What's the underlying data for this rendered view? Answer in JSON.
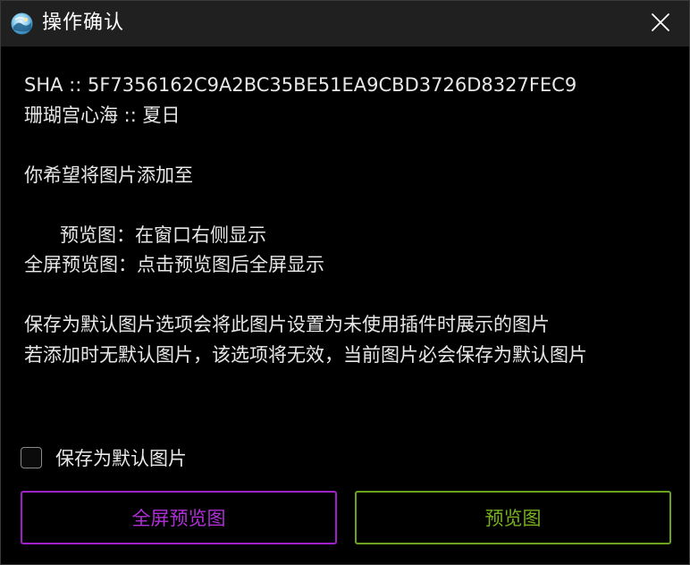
{
  "window": {
    "title": "操作确认",
    "app_icon": "genshin-app-icon",
    "close_icon": "close-icon"
  },
  "message": {
    "sha_line": "SHA :: 5F7356162C9A2BC35BE51EA9CBD3726D8327FEC9",
    "name_line": "珊瑚宫心海 :: 夏日",
    "blank1": "",
    "prompt": "你希望将图片添加至",
    "blank2": "",
    "preview_desc": "      预览图：在窗口右侧显示",
    "fullscreen_desc": "全屏预览图：点击预览图后全屏显示",
    "blank3": "",
    "default_desc_1": "保存为默认图片选项会将此图片设置为未使用插件时展示的图片",
    "default_desc_2": "若添加时无默认图片，该选项将无效，当前图片必会保存为默认图片"
  },
  "checkbox": {
    "label": "保存为默认图片",
    "checked": false
  },
  "buttons": {
    "fullscreen_label": "全屏预览图",
    "preview_label": "预览图"
  },
  "colors": {
    "titlebar_bg": "#202020",
    "body_bg": "#000000",
    "fullscreen_accent": "#a021c8",
    "preview_accent": "#6aa41e"
  }
}
